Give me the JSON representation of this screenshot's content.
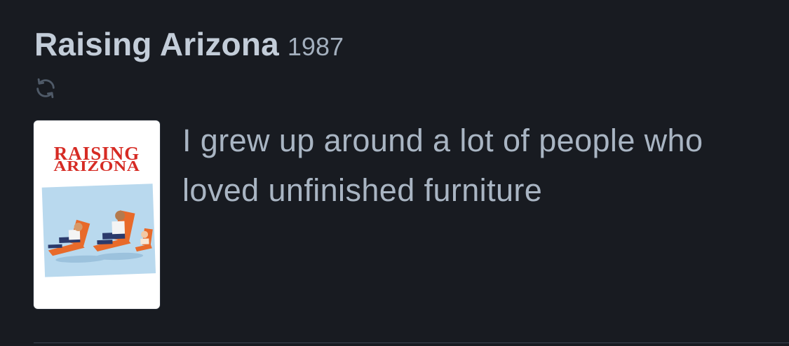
{
  "review": {
    "film_title": "Raising Arizona",
    "film_year": "1987",
    "rewatch_icon": "rewatch-icon",
    "poster": {
      "line1": "RAISING",
      "line2": "ARIZONA"
    },
    "body": "I grew up around a lot of people who loved unfinished furniture"
  },
  "colors": {
    "background": "#181b21",
    "title": "#c3cdd9",
    "text": "#a9b5c3",
    "poster_red": "#d62b24"
  }
}
